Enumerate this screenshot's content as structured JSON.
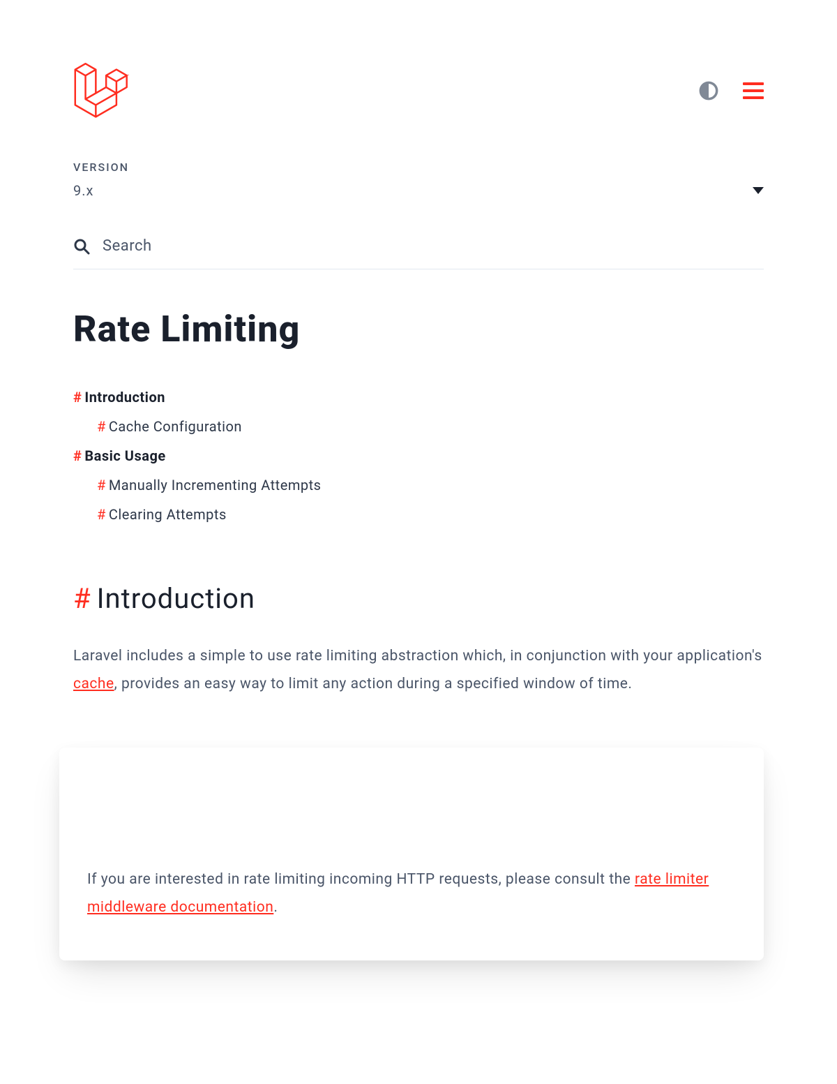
{
  "version": {
    "label": "VERSION",
    "value": "9.x"
  },
  "search": {
    "placeholder": "Search"
  },
  "page": {
    "title": "Rate Limiting"
  },
  "toc": [
    {
      "level": "top",
      "label": "Introduction"
    },
    {
      "level": "sub",
      "label": "Cache Configuration"
    },
    {
      "level": "top",
      "label": "Basic Usage"
    },
    {
      "level": "sub",
      "label": "Manually Incrementing Attempts"
    },
    {
      "level": "sub",
      "label": "Clearing Attempts"
    }
  ],
  "intro": {
    "heading": "Introduction",
    "p1a": "Laravel includes a simple to use rate limiting abstraction which, in conjunction with your application's ",
    "p1_link": "cache",
    "p1b": ", provides an easy way to limit any action during a specified window of time."
  },
  "callout": {
    "p1a": "If you are interested in rate limiting incoming HTTP requests, please consult the ",
    "link": "rate limiter middleware documentation",
    "p1b": "."
  }
}
